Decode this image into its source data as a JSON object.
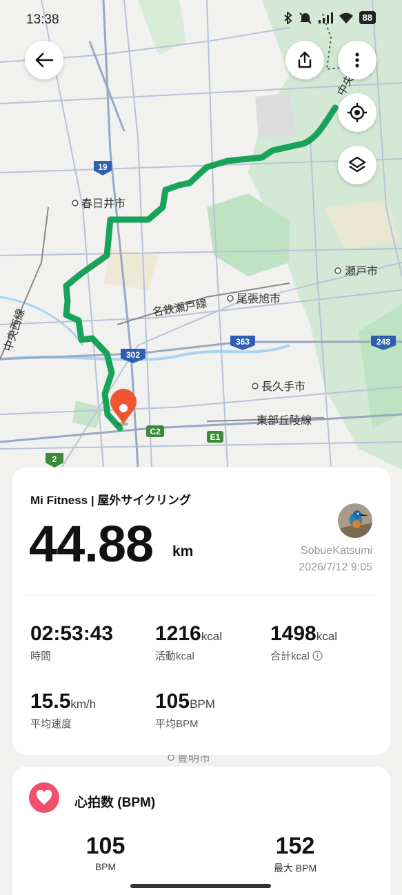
{
  "status_bar": {
    "time": "13:38",
    "battery": "88"
  },
  "map": {
    "labels": {
      "kasugai": "春日井市",
      "seto": "瀬戸市",
      "owariasahi": "尾張旭市",
      "nagakute": "長久手市",
      "toyoake": "豊明市",
      "meitetsu_seto_line": "名鉄瀬戸線",
      "tobu_kyuryo_line": "東部丘陵線",
      "chuo_nishi_line": "中央西線",
      "chuo_top": "中央"
    },
    "shields": {
      "r19": "19",
      "r302": "302",
      "r363": "363",
      "r248": "248",
      "r2": "2",
      "c2": "C2",
      "e1": "E1"
    }
  },
  "activity": {
    "header": "Mi Fitness | 屋外サイクリング",
    "distance": "44.88",
    "distance_unit": "km",
    "user": "SobueKatsumi",
    "datetime": "2026/7/12 9:05",
    "stats": {
      "duration": {
        "value": "02:53:43",
        "label": "時間"
      },
      "active_kcal": {
        "value": "1216",
        "unit": "kcal",
        "label": "活動kcal"
      },
      "total_kcal": {
        "value": "1498",
        "unit": "kcal",
        "label": "合計kcal"
      },
      "avg_speed": {
        "value": "15.5",
        "unit": "km/h",
        "label": "平均速度"
      },
      "avg_bpm": {
        "value": "105",
        "unit": "BPM",
        "label": "平均BPM"
      }
    }
  },
  "heart_rate": {
    "title": "心拍数 (BPM)",
    "avg": {
      "value": "105",
      "label": "BPM"
    },
    "max": {
      "value": "152",
      "label": "最大 BPM"
    }
  },
  "colors": {
    "route": "#19a35a",
    "pin": "#f0552f",
    "heart": "#f0506e"
  },
  "icons": [
    "back-arrow-icon",
    "share-icon",
    "more-icon",
    "locate-icon",
    "layers-icon",
    "heart-icon",
    "info-icon"
  ]
}
